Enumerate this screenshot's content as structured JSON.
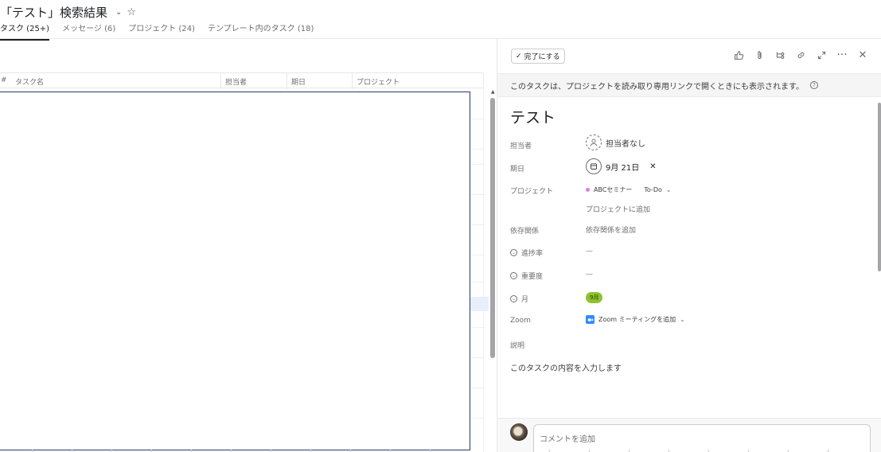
{
  "header": {
    "title": "「テスト」検索結果",
    "tabs": [
      {
        "label": "タスク (25+)",
        "active": true
      },
      {
        "label": "メッセージ (6)",
        "active": false
      },
      {
        "label": "プロジェクト (24)",
        "active": false
      },
      {
        "label": "テンプレート内のタスク (18)",
        "active": false
      }
    ]
  },
  "list": {
    "columns": {
      "index": "#",
      "name": "タスク名",
      "assignee": "担当者",
      "due": "期日",
      "project": "プロジェクト"
    }
  },
  "panel": {
    "complete_label": "完了にする",
    "toolbar_icons": [
      "thumbs-up-icon",
      "attachment-icon",
      "subtask-icon",
      "link-icon",
      "expand-icon",
      "more-icon",
      "close-icon"
    ],
    "notice": "このタスクは、プロジェクトを読み取り専用リンクで開くときにも表示されます。",
    "task_name": "テスト",
    "fields": {
      "assignee_label": "担当者",
      "assignee_value": "担当者なし",
      "due_label": "期日",
      "due_value": "9月 21日",
      "project_label": "プロジェクト",
      "project_name": "ABCセミナー",
      "project_section": "To-Do",
      "add_project": "プロジェクトに追加",
      "dependency_label": "依存関係",
      "dependency_value": "依存関係を追加",
      "progress_label": "進捗率",
      "progress_value": "—",
      "priority_label": "重要度",
      "priority_value": "—",
      "month_label": "月",
      "month_value": "9月",
      "zoom_label": "Zoom",
      "zoom_value": "Zoom ミーティングを追加",
      "description_label": "説明"
    },
    "description": "このタスクの内容を入力します",
    "comment_placeholder": "コメントを追加"
  },
  "colors": {
    "month_pill": "#8dc32e",
    "project_dot": "#e07ce0",
    "zoom": "#2d8cff"
  }
}
